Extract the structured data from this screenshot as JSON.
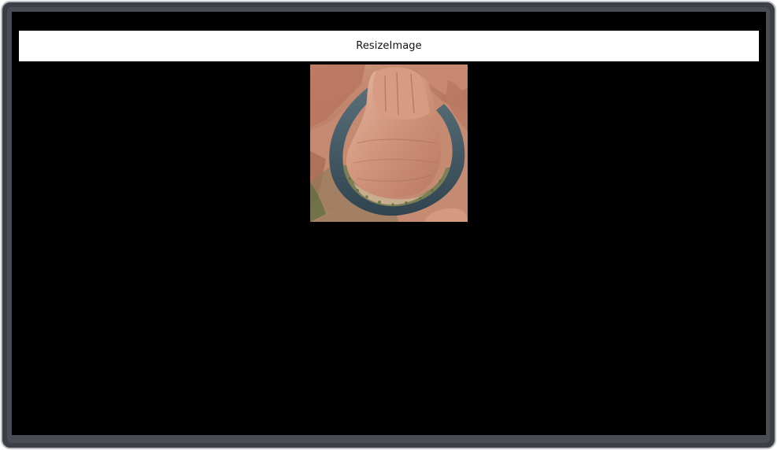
{
  "app": {
    "title": "ResizeImage"
  },
  "image": {
    "subject": "canyon-river-bend-photo",
    "colors": {
      "rock": "#c98a72",
      "rock_shadow": "#9c5f4c",
      "rock_light": "#e4b39c",
      "river": "#3f5560",
      "river_edge": "#5f7a5e",
      "vegetation": "#6f7f4a",
      "sand": "#c9b08f"
    }
  }
}
